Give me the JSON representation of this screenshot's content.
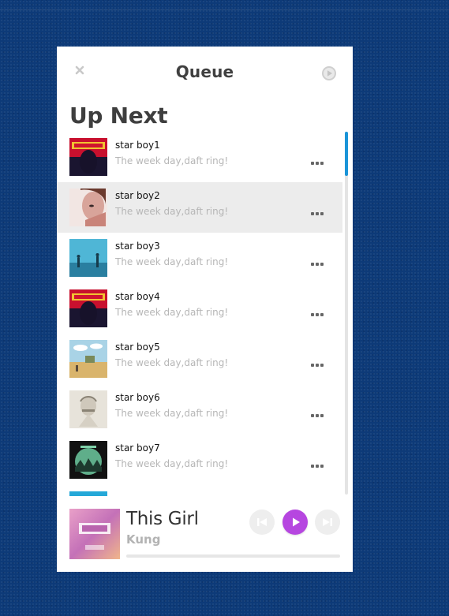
{
  "header": {
    "title": "Queue"
  },
  "section": {
    "title": "Up Next"
  },
  "queue": [
    {
      "title": "star boy1",
      "subtitle": "The week day,daft ring!",
      "art": "starboy-cover"
    },
    {
      "title": "star boy2",
      "subtitle": "The week day,daft ring!",
      "art": "portrait-cover"
    },
    {
      "title": "star boy3",
      "subtitle": "The week day,daft ring!",
      "art": "sky-cover"
    },
    {
      "title": "star boy4",
      "subtitle": "The week day,daft ring!",
      "art": "starboy-cover"
    },
    {
      "title": "star boy5",
      "subtitle": "The week day,daft ring!",
      "art": "desert-cover"
    },
    {
      "title": "star boy6",
      "subtitle": "The week day,daft ring!",
      "art": "sketch-cover"
    },
    {
      "title": "star boy7",
      "subtitle": "The week day,daft ring!",
      "art": "forest-cover"
    }
  ],
  "active_row": "star boy2",
  "now_playing": {
    "title": "This Girl",
    "artist": "Kung",
    "progress": 0
  },
  "icons": {
    "close": "close-icon",
    "play_top": "play-circle-icon",
    "more": "more-dots-icon",
    "previous": "skip-previous-icon",
    "play": "play-icon",
    "next": "skip-next-icon"
  },
  "colors": {
    "background": "#0d3a78",
    "accent_scroll": "#1a94d8",
    "play_button": "#b646e0",
    "active_row": "#ececec"
  }
}
